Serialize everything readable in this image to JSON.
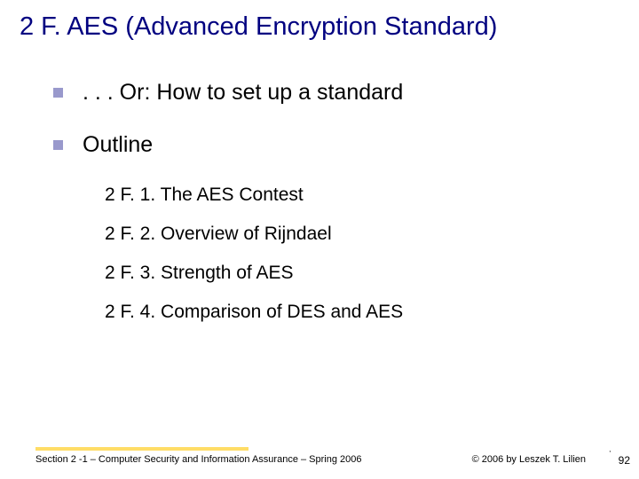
{
  "title": "2 F. AES (Advanced Encryption Standard)",
  "bullets": [
    {
      "text": ". . . Or: How to set up a standard"
    },
    {
      "text": "Outline"
    }
  ],
  "outline": [
    "2 F. 1. The AES Contest",
    "2 F. 2. Overview of Rijndael",
    "2 F. 3. Strength of AES",
    "2 F. 4. Comparison of DES and AES"
  ],
  "footer": {
    "left": "Section 2 -1 – Computer Security and Information Assurance – Spring 2006",
    "right": "© 2006 by Leszek T. Lilien",
    "page": "92",
    "tick": "'"
  }
}
